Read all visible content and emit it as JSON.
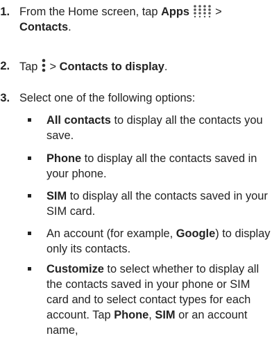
{
  "steps": [
    {
      "num": "1.",
      "t1": "From the Home screen, tap ",
      "b1": "Apps",
      "icon": "apps-grid-icon",
      "t2": " > ",
      "b2": "Contacts",
      "t3": "."
    },
    {
      "num": "2.",
      "t1": "Tap ",
      "icon": "menu-dots-icon",
      "t2": " > ",
      "b1": "Contacts to display",
      "t3": "."
    },
    {
      "num": "3.",
      "t1": "Select one of the following options:"
    }
  ],
  "options": [
    {
      "b1": "All contacts",
      "t1": " to display all the contacts you save."
    },
    {
      "b1": "Phone",
      "t1": " to display all the contacts saved in your phone."
    },
    {
      "b1": "SIM",
      "t1": " to display all the contacts saved in your SIM card."
    },
    {
      "t1": "An account (for example, ",
      "b1": "Google",
      "t2": ") to display only its contacts."
    },
    {
      "b1": "Customize",
      "t1": " to select whether to display all the contacts saved in your phone or SIM card and to select contact types for each account. Tap ",
      "b2": "Phone",
      "t2": ", ",
      "b3": "SIM",
      "t3": " or an account name,"
    }
  ]
}
